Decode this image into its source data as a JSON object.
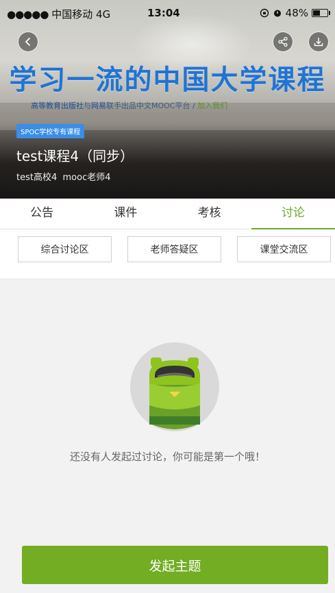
{
  "status_bar": {
    "signal": "●●●●●",
    "carrier": "中国移动",
    "network": "4G",
    "time": "13:04",
    "battery": "48%"
  },
  "banner": {
    "title": "学习一流的中国大学课程",
    "subtitle_publisher": "高等教育出版社",
    "subtitle_and": "与",
    "subtitle_netease": "网易",
    "subtitle_rest": "联手出品中文MOOC平台 / ",
    "subtitle_join": "加入我们"
  },
  "course": {
    "badge": "SPOC学校专有课程",
    "title": "test课程4（同步）",
    "school": "test高校4",
    "teacher": "mooc老师4"
  },
  "tabs": [
    {
      "label": "公告"
    },
    {
      "label": "课件"
    },
    {
      "label": "考核"
    },
    {
      "label": "讨论"
    }
  ],
  "active_tab": "讨论",
  "forum_filters": [
    {
      "label": "综合讨论区"
    },
    {
      "label": "老师答疑区"
    },
    {
      "label": "课堂交流区"
    }
  ],
  "empty_state": {
    "icon": "backpack-icon",
    "message": "还没有人发起过讨论，你可能是第一个哦！"
  },
  "actions": {
    "post_label": "发起主题"
  },
  "colors": {
    "accent_green": "#6aaa2a",
    "button_green": "#72ad23",
    "banner_blue": "#1f74d4",
    "badge_blue": "#3a8ee6"
  }
}
